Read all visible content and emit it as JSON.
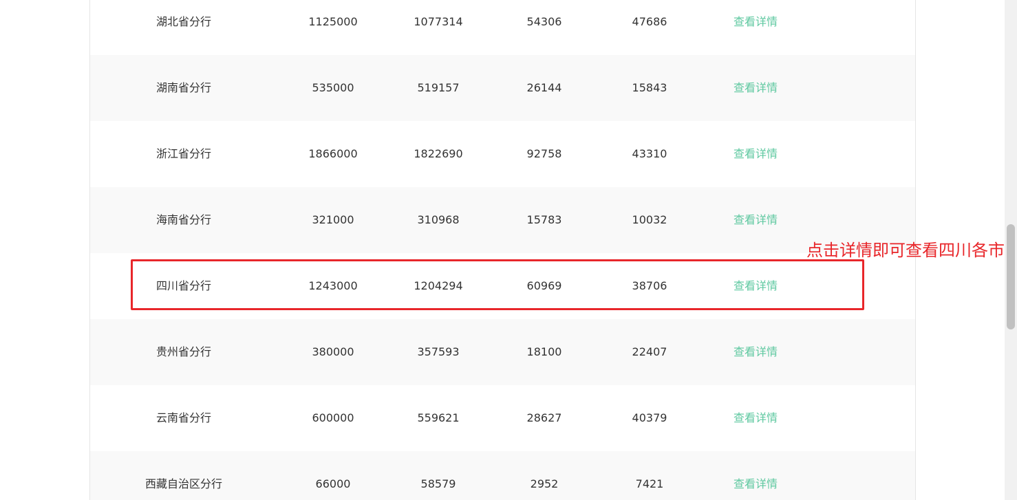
{
  "rows": [
    {
      "name": "湖北省分行",
      "a": "1125000",
      "b": "1077314",
      "c": "54306",
      "d": "47686",
      "link": "查看详情"
    },
    {
      "name": "湖南省分行",
      "a": "535000",
      "b": "519157",
      "c": "26144",
      "d": "15843",
      "link": "查看详情"
    },
    {
      "name": "浙江省分行",
      "a": "1866000",
      "b": "1822690",
      "c": "92758",
      "d": "43310",
      "link": "查看详情"
    },
    {
      "name": "海南省分行",
      "a": "321000",
      "b": "310968",
      "c": "15783",
      "d": "10032",
      "link": "查看详情"
    },
    {
      "name": "四川省分行",
      "a": "1243000",
      "b": "1204294",
      "c": "60969",
      "d": "38706",
      "link": "查看详情"
    },
    {
      "name": "贵州省分行",
      "a": "380000",
      "b": "357593",
      "c": "18100",
      "d": "22407",
      "link": "查看详情"
    },
    {
      "name": "云南省分行",
      "a": "600000",
      "b": "559621",
      "c": "28627",
      "d": "40379",
      "link": "查看详情"
    },
    {
      "name": "西藏自治区分行",
      "a": "66000",
      "b": "58579",
      "c": "2952",
      "d": "7421",
      "link": "查看详情"
    }
  ],
  "annotation": {
    "text": "点击详情即可查看四川各市",
    "color": "#e8262a"
  },
  "colors": {
    "link": "#5ec8a0",
    "alt_row": "#f9f9f9",
    "highlight": "#e8262a"
  }
}
